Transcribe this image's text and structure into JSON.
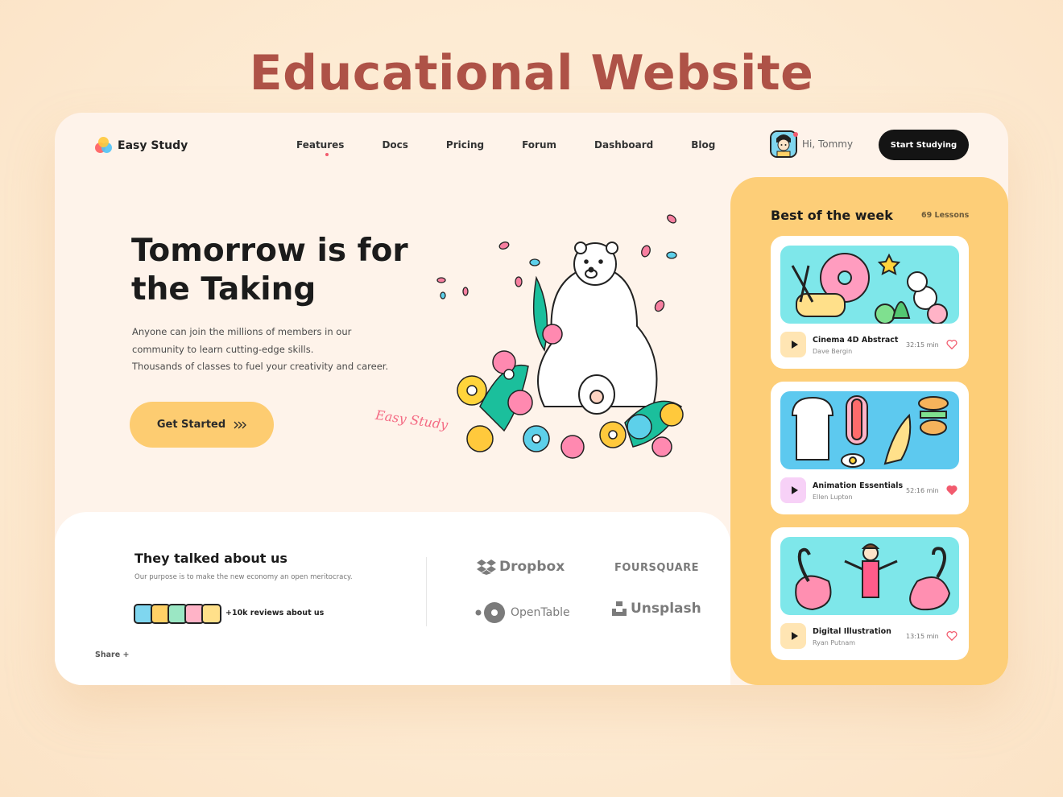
{
  "showcase": {
    "title": "Educational Website"
  },
  "brand": {
    "name": "Easy Study"
  },
  "nav": {
    "items": [
      "Features",
      "Docs",
      "Pricing",
      "Forum",
      "Dashboard",
      "Blog"
    ],
    "active": "Features"
  },
  "user": {
    "greeting": "Hi, Tommy"
  },
  "header": {
    "cta_label": "Start Studying"
  },
  "hero": {
    "title_line1": "Tomorrow is for",
    "title_line2": "the Taking",
    "subtitle_line1": "Anyone can join the millions of members in our",
    "subtitle_line2": "community to learn cutting-edge skills.",
    "subtitle_line3": "Thousands of classes to fuel your creativity and career.",
    "cta_label": "Get Started",
    "cta_icon": "chevrons-right-icon",
    "signature": "Easy Study"
  },
  "social": {
    "title": "They talked about us",
    "subtitle": "Our purpose is to make the new economy an open meritocracy.",
    "reviews": "+10k reviews about us",
    "share_label": "Share +",
    "brands": [
      "Dropbox",
      "FOURSQUARE",
      "OpenTable",
      "Unsplash"
    ]
  },
  "panel": {
    "title": "Best of the week",
    "count": "69 Lessons",
    "lessons": [
      {
        "title": "Cinema 4D Abstract",
        "author": "Dave Bergin",
        "duration": "32:15 min",
        "liked": false
      },
      {
        "title": "Animation Essentials",
        "author": "Ellen Lupton",
        "duration": "52:16 min",
        "liked": true
      },
      {
        "title": "Digital Illustration",
        "author": "Ryan Putnam",
        "duration": "13:15 min",
        "liked": false
      }
    ]
  },
  "colors": {
    "title": "#ae5247",
    "accent_yellow": "#fdcc71",
    "panel_yellow": "#fdce78",
    "pink": "#f25b6e",
    "dark": "#141414"
  }
}
